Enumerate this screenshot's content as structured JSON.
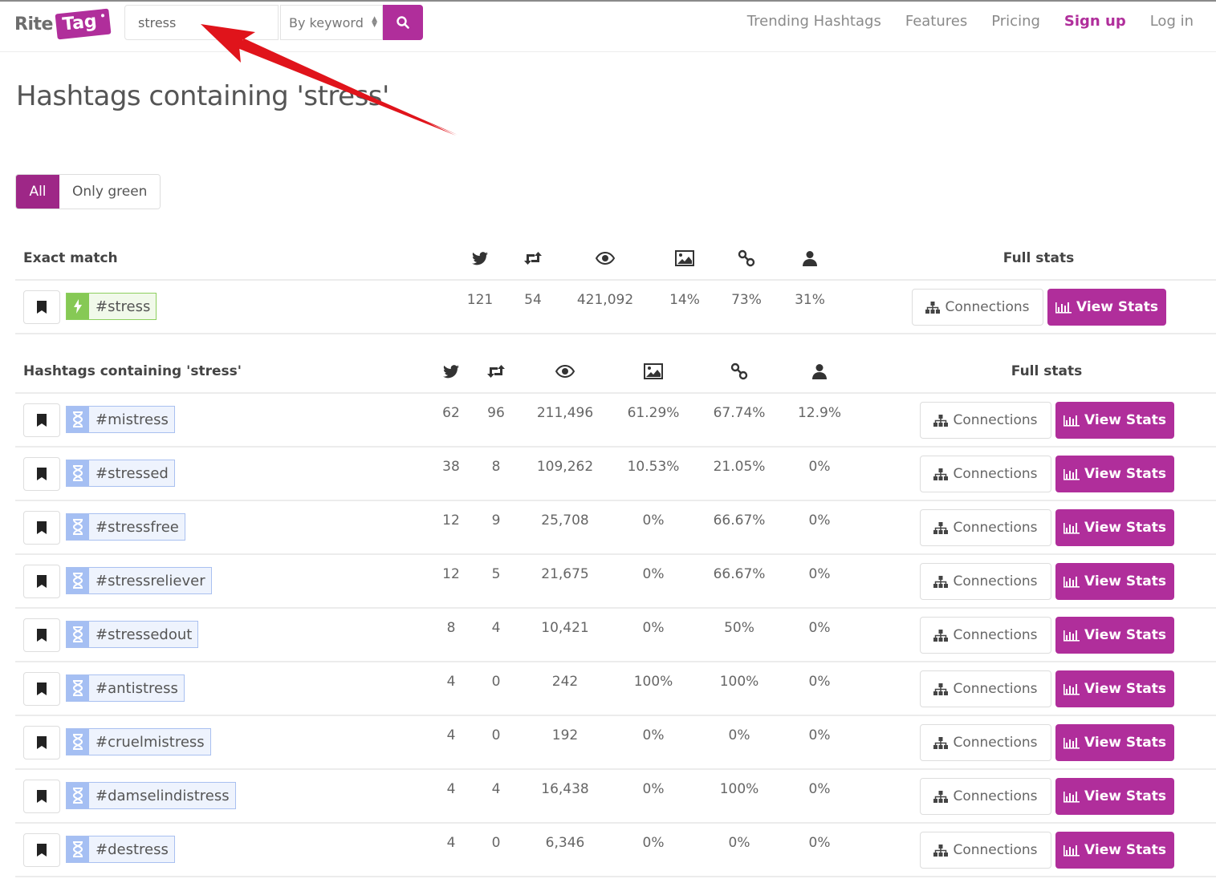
{
  "header": {
    "logo_rite": "Rite",
    "logo_tag": "Tag",
    "search_value": "stress",
    "search_mode": "By keyword",
    "nav": [
      {
        "label": "Trending Hashtags"
      },
      {
        "label": "Features"
      },
      {
        "label": "Pricing"
      },
      {
        "label": "Sign up"
      },
      {
        "label": "Log in"
      }
    ],
    "accent_color": "#b02e9b"
  },
  "page_title": "Hashtags containing 'stress'",
  "filters": {
    "all": "All",
    "only_green": "Only green",
    "selected": "All"
  },
  "columns": {
    "icons": [
      "twitter-icon",
      "retweet-icon",
      "eye-icon",
      "image-icon",
      "link-icon",
      "user-icon"
    ],
    "full_stats": "Full stats"
  },
  "buttons": {
    "connections": "Connections",
    "view_stats": "View Stats"
  },
  "exact_match": {
    "title": "Exact match",
    "row": {
      "tag": "#stress",
      "status": "green",
      "tweets": "121",
      "retweets": "54",
      "exposure": "421,092",
      "images": "14%",
      "links": "73%",
      "mentions": "31%"
    }
  },
  "containing": {
    "title": "Hashtags containing 'stress'",
    "rows": [
      {
        "tag": "#mistress",
        "status": "blue",
        "tweets": "62",
        "retweets": "96",
        "exposure": "211,496",
        "images": "61.29%",
        "links": "67.74%",
        "mentions": "12.9%"
      },
      {
        "tag": "#stressed",
        "status": "blue",
        "tweets": "38",
        "retweets": "8",
        "exposure": "109,262",
        "images": "10.53%",
        "links": "21.05%",
        "mentions": "0%"
      },
      {
        "tag": "#stressfree",
        "status": "blue",
        "tweets": "12",
        "retweets": "9",
        "exposure": "25,708",
        "images": "0%",
        "links": "66.67%",
        "mentions": "0%"
      },
      {
        "tag": "#stressreliever",
        "status": "blue",
        "tweets": "12",
        "retweets": "5",
        "exposure": "21,675",
        "images": "0%",
        "links": "66.67%",
        "mentions": "0%"
      },
      {
        "tag": "#stressedout",
        "status": "blue",
        "tweets": "8",
        "retweets": "4",
        "exposure": "10,421",
        "images": "0%",
        "links": "50%",
        "mentions": "0%"
      },
      {
        "tag": "#antistress",
        "status": "blue",
        "tweets": "4",
        "retweets": "0",
        "exposure": "242",
        "images": "100%",
        "links": "100%",
        "mentions": "0%"
      },
      {
        "tag": "#cruelmistress",
        "status": "blue",
        "tweets": "4",
        "retweets": "0",
        "exposure": "192",
        "images": "0%",
        "links": "0%",
        "mentions": "0%"
      },
      {
        "tag": "#damselindistress",
        "status": "blue",
        "tweets": "4",
        "retweets": "4",
        "exposure": "16,438",
        "images": "0%",
        "links": "100%",
        "mentions": "0%"
      },
      {
        "tag": "#destress",
        "status": "blue",
        "tweets": "4",
        "retweets": "0",
        "exposure": "6,346",
        "images": "0%",
        "links": "0%",
        "mentions": "0%"
      }
    ]
  },
  "status_colors": {
    "green": "#86c955",
    "blue": "#a5bff3"
  }
}
